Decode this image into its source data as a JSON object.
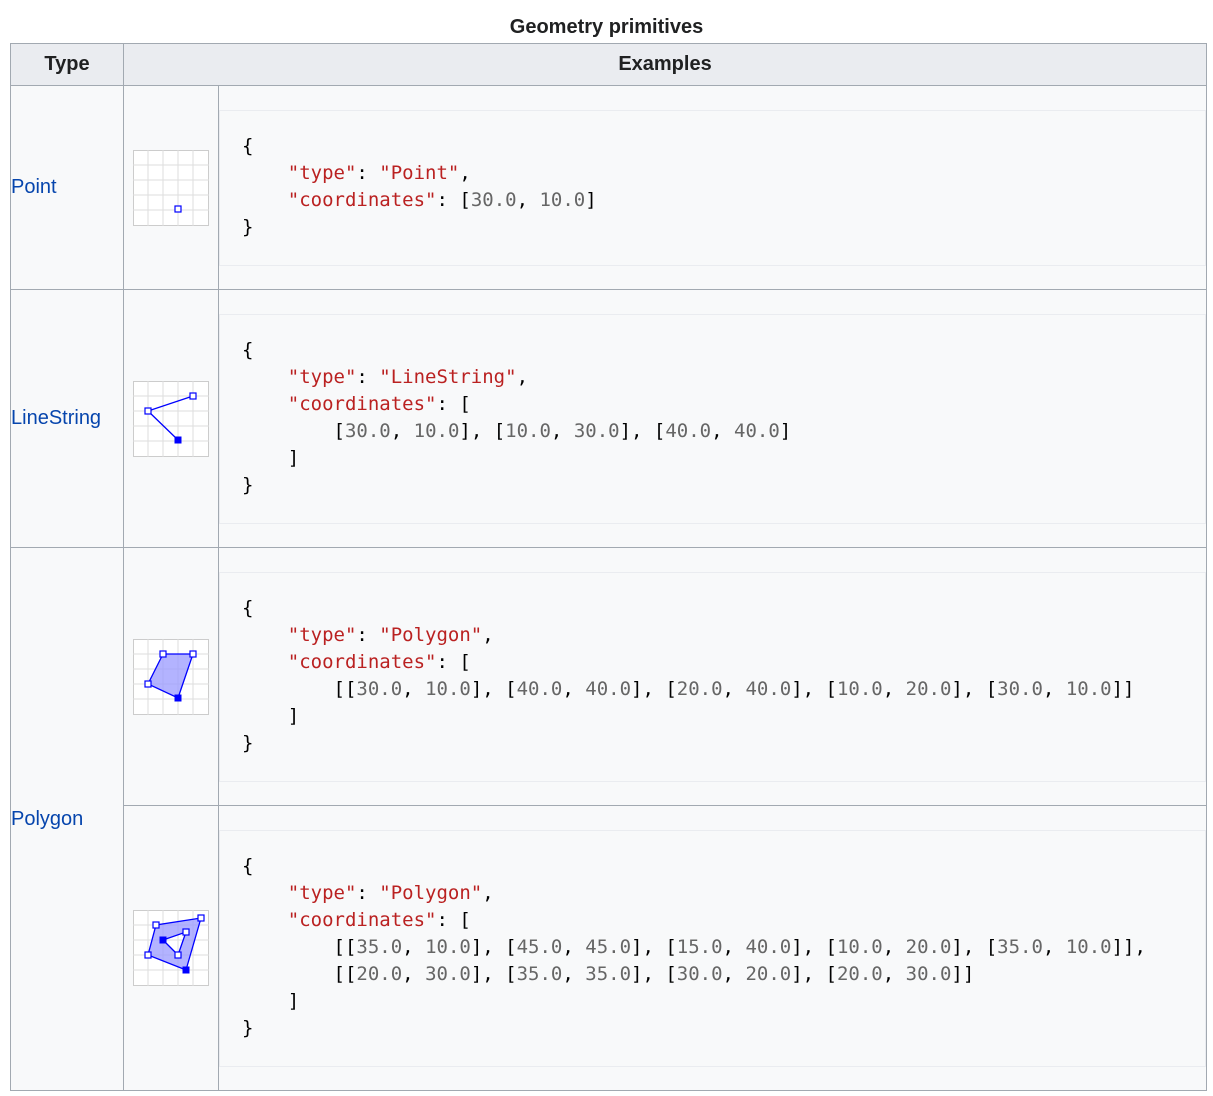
{
  "caption": "Geometry primitives",
  "headers": {
    "type": "Type",
    "examples": "Examples"
  },
  "rows": [
    {
      "type": "Point",
      "icon": "point-geometry-icon",
      "code": {
        "open": "{",
        "type_key": "\"type\"",
        "type_value": "\"Point\"",
        "coord_key": "\"coordinates\"",
        "coords": [
          "30.0",
          "10.0"
        ],
        "close": "}"
      }
    },
    {
      "type": "LineString",
      "icon": "linestring-geometry-icon",
      "code": {
        "open": "{",
        "type_key": "\"type\"",
        "type_value": "\"LineString\"",
        "coord_key": "\"coordinates\"",
        "coords": [
          [
            "30.0",
            "10.0"
          ],
          [
            "10.0",
            "30.0"
          ],
          [
            "40.0",
            "40.0"
          ]
        ],
        "close": "}"
      }
    },
    {
      "type": "Polygon",
      "examples": [
        {
          "icon": "polygon-geometry-icon",
          "code": {
            "open": "{",
            "type_key": "\"type\"",
            "type_value": "\"Polygon\"",
            "coord_key": "\"coordinates\"",
            "rings": [
              [
                [
                  "30.0",
                  "10.0"
                ],
                [
                  "40.0",
                  "40.0"
                ],
                [
                  "20.0",
                  "40.0"
                ],
                [
                  "10.0",
                  "20.0"
                ],
                [
                  "30.0",
                  "10.0"
                ]
              ]
            ],
            "close": "}"
          }
        },
        {
          "icon": "polygon-with-hole-geometry-icon",
          "code": {
            "open": "{",
            "type_key": "\"type\"",
            "type_value": "\"Polygon\"",
            "coord_key": "\"coordinates\"",
            "rings": [
              [
                [
                  "35.0",
                  "10.0"
                ],
                [
                  "45.0",
                  "45.0"
                ],
                [
                  "15.0",
                  "40.0"
                ],
                [
                  "10.0",
                  "20.0"
                ],
                [
                  "35.0",
                  "10.0"
                ]
              ],
              [
                [
                  "20.0",
                  "30.0"
                ],
                [
                  "35.0",
                  "35.0"
                ],
                [
                  "30.0",
                  "20.0"
                ],
                [
                  "20.0",
                  "30.0"
                ]
              ]
            ],
            "close": "}"
          }
        }
      ]
    }
  ],
  "colors": {
    "link": "#0645ad",
    "string": "#ba2121",
    "number": "#666666",
    "header_bg": "#eaecf0",
    "border": "#a2a9b1",
    "geometry": "#0000ff"
  }
}
